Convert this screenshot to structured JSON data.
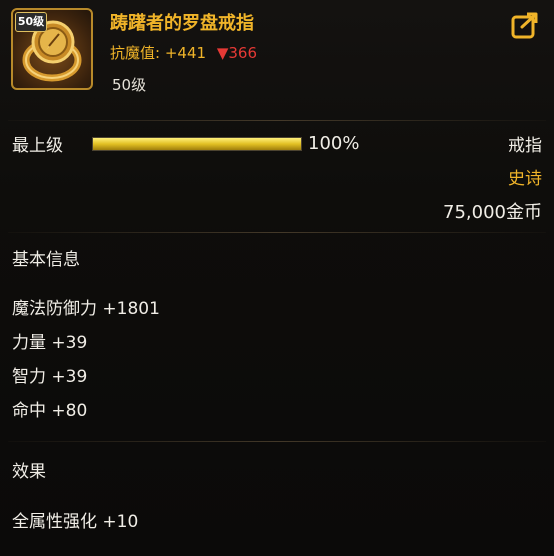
{
  "item": {
    "level_badge": "50级",
    "name": "踌躇者的罗盘戒指",
    "stat_label": "抗魔值:",
    "stat_up": "+441",
    "stat_down_arrow": "▼",
    "stat_down": "366",
    "required_level": "50级"
  },
  "quality": {
    "label": "最上级",
    "percent_value": 1.0,
    "percent_text": "100%"
  },
  "meta": {
    "type": "戒指",
    "rarity": "史诗",
    "price": "75,000金币"
  },
  "basic_info": {
    "title": "基本信息",
    "attributes": [
      "魔法防御力 +1801",
      "力量 +39",
      "智力 +39",
      "命中 +80"
    ]
  },
  "effects": {
    "title": "效果",
    "items": [
      "全属性强化 +10"
    ]
  },
  "colors": {
    "epic": "#f0b429",
    "decrease": "#e53935",
    "bar_fill": "#e2c023"
  },
  "icons": {
    "share": "share-icon",
    "item": "ring-icon"
  }
}
